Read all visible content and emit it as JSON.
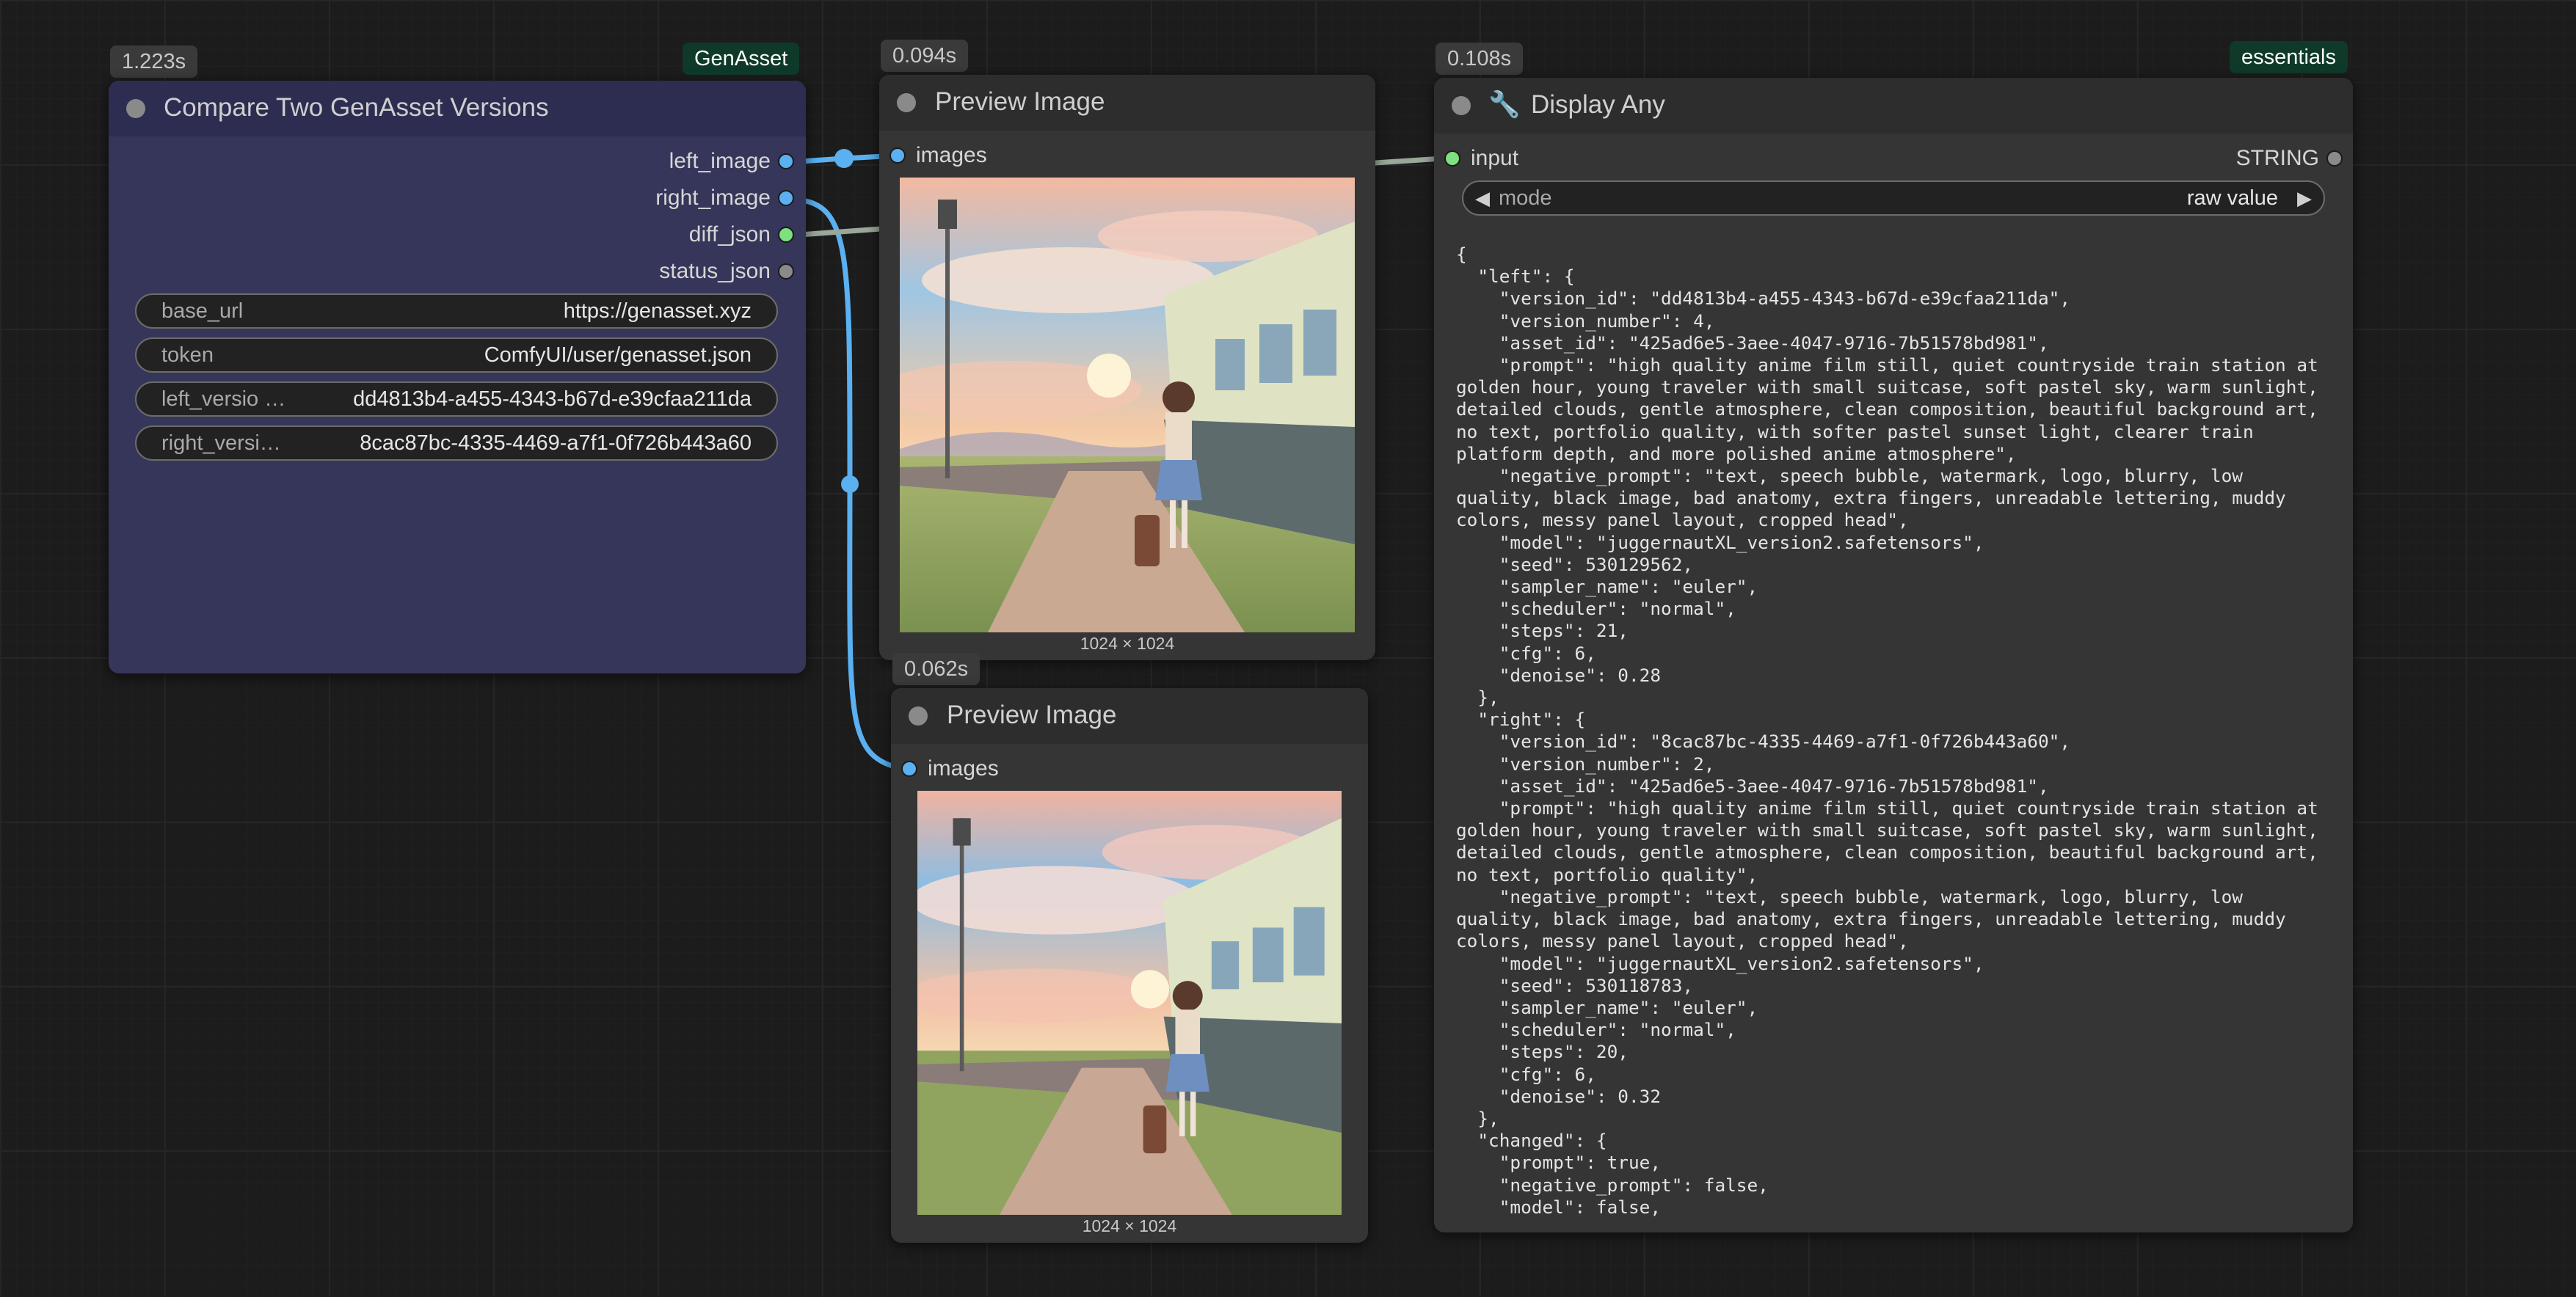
{
  "colors": {
    "image_wire": "#5ab0f0",
    "string_wire": "#9aa89a",
    "compare_node_bg": "#36365a",
    "compare_node_header": "#2d2d52",
    "badge_tag_bg": "#0f3a2a"
  },
  "compare_node": {
    "time": "1.223s",
    "tag": "GenAsset",
    "title": "Compare Two GenAsset Versions",
    "outputs": [
      {
        "label": "left_image",
        "color": "#5ab0f0"
      },
      {
        "label": "right_image",
        "color": "#5ab0f0"
      },
      {
        "label": "diff_json",
        "color": "#7ee07e"
      },
      {
        "label": "status_json",
        "color": "#8a8a8a"
      }
    ],
    "widgets": [
      {
        "label": "base_url",
        "value": "https://genasset.xyz"
      },
      {
        "label": "token",
        "value": "ComfyUI/user/genasset.json"
      },
      {
        "label": "left_versio …",
        "value": "dd4813b4-a455-4343-b67d-e39cfaa211da"
      },
      {
        "label": "right_versi…",
        "value": "8cac87bc-4335-4469-a7f1-0f726b443a60"
      }
    ]
  },
  "preview_top": {
    "time": "0.094s",
    "title": "Preview Image",
    "input_label": "images",
    "caption": "1024 × 1024"
  },
  "preview_bottom": {
    "time": "0.062s",
    "title": "Preview Image",
    "input_label": "images",
    "caption": "1024 × 1024"
  },
  "display_node": {
    "time": "0.108s",
    "tag": "essentials",
    "icon": "wrench-icon",
    "title": "Display Any",
    "input_label": "input",
    "output_label": "STRING",
    "mode_label": "mode",
    "mode_value": "raw value",
    "text": "{\n  \"left\": {\n    \"version_id\": \"dd4813b4-a455-4343-b67d-e39cfaa211da\",\n    \"version_number\": 4,\n    \"asset_id\": \"425ad6e5-3aee-4047-9716-7b51578bd981\",\n    \"prompt\": \"high quality anime film still, quiet countryside train station at golden hour, young traveler with small suitcase, soft pastel sky, warm sunlight, detailed clouds, gentle atmosphere, clean composition, beautiful background art, no text, portfolio quality, with softer pastel sunset light, clearer train platform depth, and more polished anime atmosphere\",\n    \"negative_prompt\": \"text, speech bubble, watermark, logo, blurry, low quality, black image, bad anatomy, extra fingers, unreadable lettering, muddy colors, messy panel layout, cropped head\",\n    \"model\": \"juggernautXL_version2.safetensors\",\n    \"seed\": 530129562,\n    \"sampler_name\": \"euler\",\n    \"scheduler\": \"normal\",\n    \"steps\": 21,\n    \"cfg\": 6,\n    \"denoise\": 0.28\n  },\n  \"right\": {\n    \"version_id\": \"8cac87bc-4335-4469-a7f1-0f726b443a60\",\n    \"version_number\": 2,\n    \"asset_id\": \"425ad6e5-3aee-4047-9716-7b51578bd981\",\n    \"prompt\": \"high quality anime film still, quiet countryside train station at golden hour, young traveler with small suitcase, soft pastel sky, warm sunlight, detailed clouds, gentle atmosphere, clean composition, beautiful background art, no text, portfolio quality\",\n    \"negative_prompt\": \"text, speech bubble, watermark, logo, blurry, low quality, black image, bad anatomy, extra fingers, unreadable lettering, muddy colors, messy panel layout, cropped head\",\n    \"model\": \"juggernautXL_version2.safetensors\",\n    \"seed\": 530118783,\n    \"sampler_name\": \"euler\",\n    \"scheduler\": \"normal\",\n    \"steps\": 20,\n    \"cfg\": 6,\n    \"denoise\": 0.32\n  },\n  \"changed\": {\n    \"prompt\": true,\n    \"negative_prompt\": false,\n    \"model\": false,"
  }
}
